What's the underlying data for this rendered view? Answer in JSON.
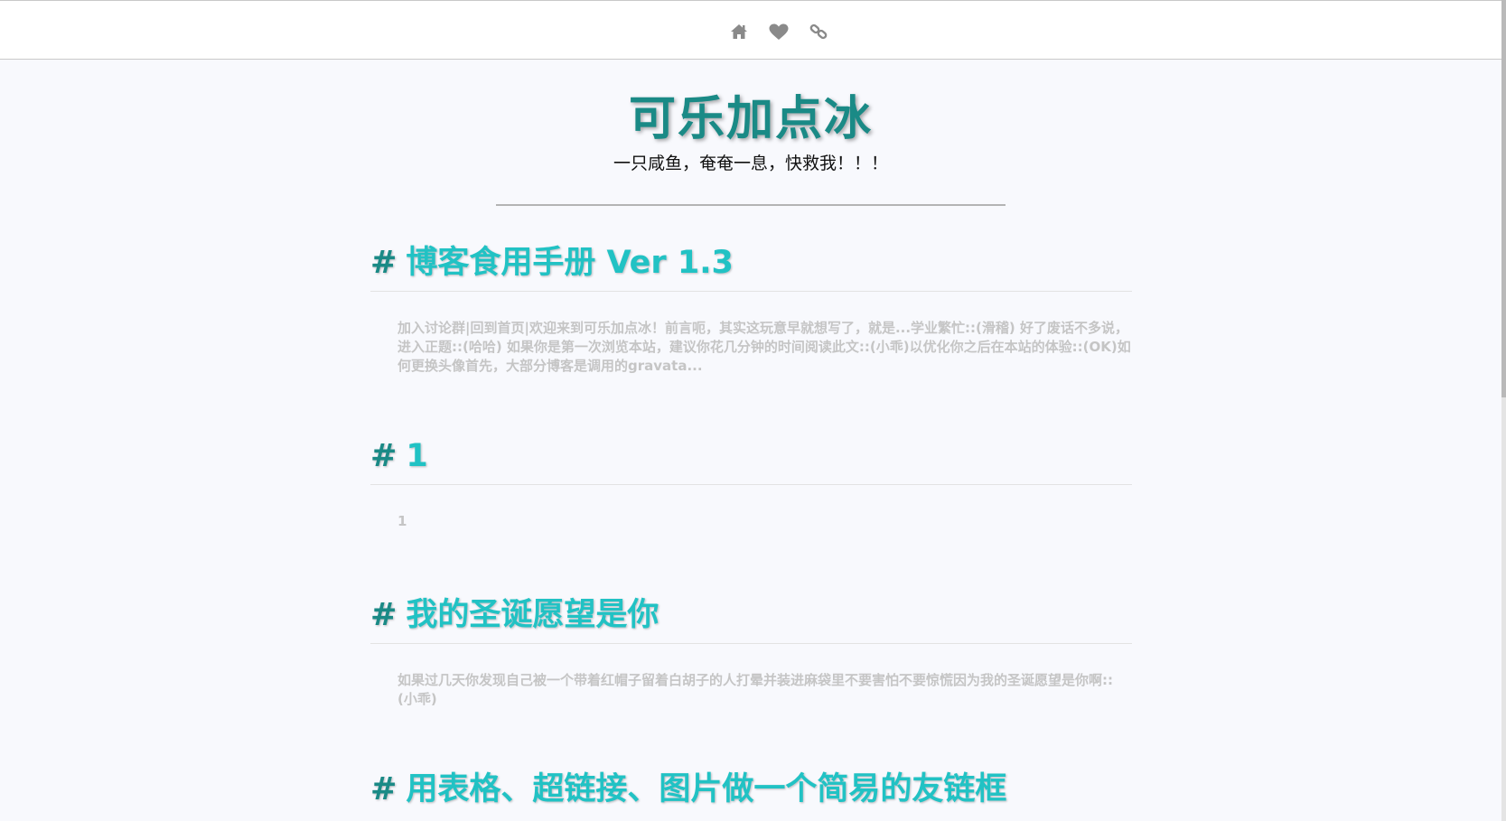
{
  "nav": {
    "icons": [
      "home-icon",
      "heart-icon",
      "link-icon"
    ],
    "icon_color": "#8a8a8a"
  },
  "site": {
    "title": "可乐加点冰",
    "subtitle": "一只咸鱼，奄奄一息，快救我！！！"
  },
  "colors": {
    "title": "#1a8a86",
    "post_title": "#21c2c4",
    "hash": "#1a8a86",
    "excerpt": "#c5c5c5",
    "background": "#f8f9fd"
  },
  "posts": [
    {
      "hash": "#",
      "title": "博客食用手册 Ver 1.3",
      "excerpt": "加入讨论群|回到首页|欢迎来到可乐加点冰！前言呃，其实这玩意早就想写了，就是...学业繁忙::(滑稽) 好了废话不多说，进入正题::(哈哈) 如果你是第一次浏览本站，建议你花几分钟的时间阅读此文::(小乖)以优化你之后在本站的体验::(OK)如何更换头像首先，大部分博客是调用的gravata..."
    },
    {
      "hash": "#",
      "title": "1",
      "excerpt": "1"
    },
    {
      "hash": "#",
      "title": "我的圣诞愿望是你",
      "excerpt": "如果过几天你发现自己被一个带着红帽子留着白胡子的人打晕并装进麻袋里不要害怕不要惊慌因为我的圣诞愿望是你啊::(小乖)"
    },
    {
      "hash": "#",
      "title": "用表格、超链接、图片做一个简易的友链框",
      "excerpt": ""
    }
  ]
}
